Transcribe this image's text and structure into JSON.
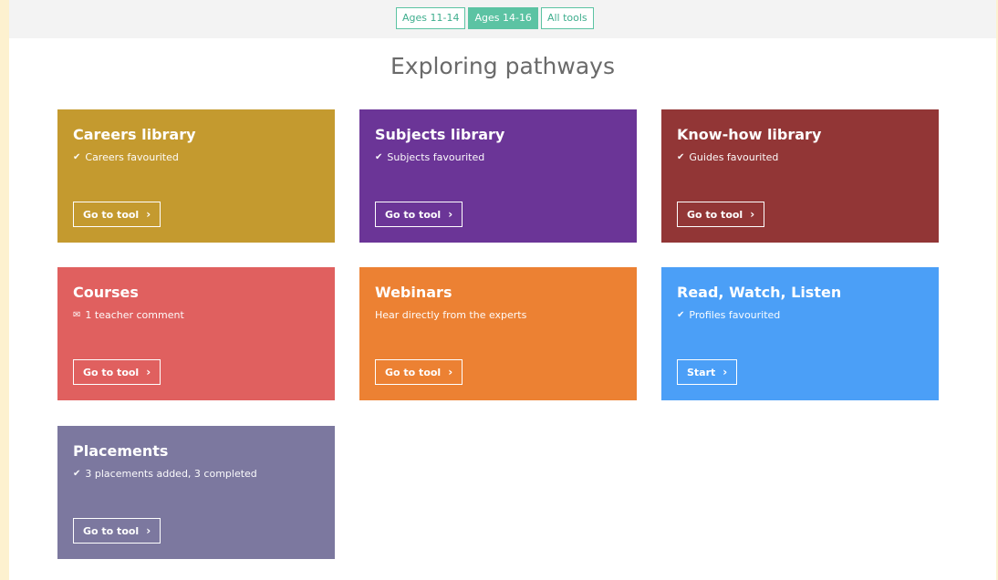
{
  "tabs": [
    {
      "label": "Ages 11-14",
      "active": false
    },
    {
      "label": "Ages 14-16",
      "active": true
    },
    {
      "label": "All tools",
      "active": false
    }
  ],
  "page_title": "Exploring pathways",
  "cards": [
    {
      "title": "Careers library",
      "subtitle": "Careers favourited",
      "icon": "check-icon",
      "button": "Go to tool",
      "color": "#c49a2f"
    },
    {
      "title": "Subjects library",
      "subtitle": "Subjects favourited",
      "icon": "check-icon",
      "button": "Go to tool",
      "color": "#6b3597"
    },
    {
      "title": "Know-how library",
      "subtitle": "Guides favourited",
      "icon": "check-icon",
      "button": "Go to tool",
      "color": "#923636"
    },
    {
      "title": "Courses",
      "subtitle": "1 teacher comment",
      "icon": "envelope-icon",
      "button": "Go to tool",
      "color": "#e0605f"
    },
    {
      "title": "Webinars",
      "subtitle": "Hear directly from the experts",
      "icon": "",
      "button": "Go to tool",
      "color": "#ec8133"
    },
    {
      "title": "Read, Watch, Listen",
      "subtitle": "Profiles favourited",
      "icon": "check-icon",
      "button": "Start",
      "color": "#4b9ff7"
    },
    {
      "title": "Placements",
      "subtitle": "3 placements added, 3 completed",
      "icon": "check-icon",
      "button": "Go to tool",
      "color": "#7c789f"
    }
  ]
}
